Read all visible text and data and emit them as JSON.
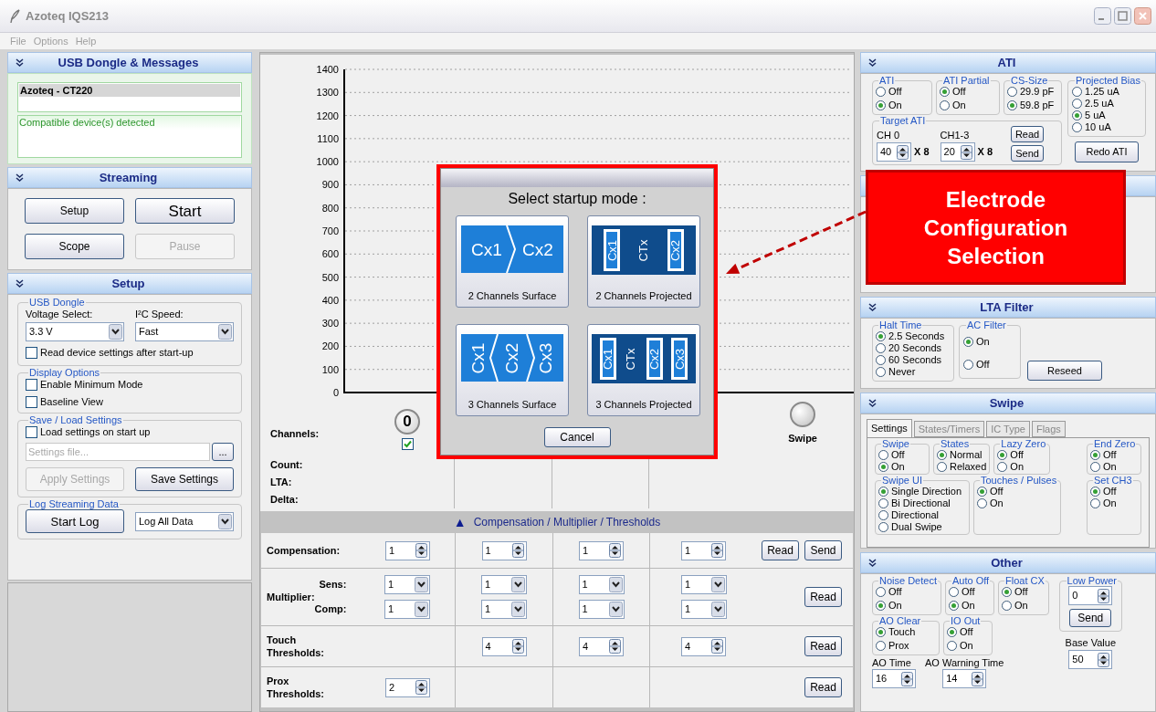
{
  "window": {
    "title": "Azoteq IQS213"
  },
  "menu": [
    "File",
    "Options",
    "Help"
  ],
  "usb_panel": {
    "title": "USB Dongle & Messages",
    "device": "Azoteq - CT220",
    "message": "Compatible device(s) detected"
  },
  "streaming_panel": {
    "title": "Streaming",
    "buttons": [
      {
        "label": "Setup",
        "disabled": false,
        "default": false
      },
      {
        "label": "Start",
        "disabled": false,
        "default": true
      },
      {
        "label": "Scope",
        "disabled": false,
        "default": false
      },
      {
        "label": "Pause",
        "disabled": true,
        "default": false
      }
    ]
  },
  "setup_panel": {
    "title": "Setup",
    "usb_dongle": {
      "title": "USB Dongle",
      "dropdowns": [
        {
          "label": "Voltage Select:",
          "value": "3.3 V"
        },
        {
          "label": "I²C Speed:",
          "value": "Fast"
        }
      ],
      "checkbox": {
        "label": "Read device settings after start-up",
        "checked": false
      }
    },
    "display_options": {
      "title": "Display Options",
      "checkboxes": [
        {
          "label": "Enable Minimum Mode",
          "checked": false
        },
        {
          "label": "Baseline View",
          "checked": false
        }
      ]
    },
    "save_load": {
      "title": "Save / Load Settings",
      "checkbox": {
        "label": "Load settings on start up",
        "checked": false
      },
      "file_field": {
        "placeholder": "Settings file..."
      },
      "browse_button": "...",
      "buttons": [
        {
          "label": "Apply Settings",
          "disabled": true
        },
        {
          "label": "Save Settings",
          "disabled": false
        }
      ]
    },
    "log_streaming": {
      "title": "Log Streaming Data",
      "button": "Start Log",
      "dropdown": "Log All Data"
    }
  },
  "chart": {
    "y_axis_labels": [
      "1400",
      "1300",
      "1200",
      "1100",
      "1000",
      "900",
      "800",
      "700",
      "600",
      "500",
      "400",
      "300",
      "200",
      "100",
      "0"
    ],
    "channels_label": "Channels:",
    "channel": {
      "number": "0",
      "checked": true
    },
    "swipe_label": "Swipe",
    "readouts": [
      "Count:",
      "LTA:",
      "Delta:"
    ]
  },
  "table": {
    "toggle": "▲",
    "title": "Compensation / Multiplier / Thresholds",
    "rows": [
      {
        "label": "Compensation:",
        "lines": [
          {
            "cells": [
              {
                "kind": "spin",
                "value": "1"
              },
              {
                "kind": "spin",
                "value": "1"
              },
              {
                "kind": "spin",
                "value": "1"
              },
              {
                "kind": "spin",
                "value": "1"
              }
            ]
          }
        ],
        "buttons": [
          "Read",
          "Send"
        ]
      },
      {
        "label": "Multiplier:",
        "lines": [
          {
            "sublabel": "Sens:",
            "cells": [
              {
                "kind": "dropdown",
                "value": "1"
              },
              {
                "kind": "dropdown",
                "value": "1"
              },
              {
                "kind": "dropdown",
                "value": "1"
              },
              {
                "kind": "dropdown",
                "value": "1"
              }
            ]
          },
          {
            "sublabel": "Comp:",
            "cells": [
              {
                "kind": "dropdown",
                "value": "1"
              },
              {
                "kind": "dropdown",
                "value": "1"
              },
              {
                "kind": "dropdown",
                "value": "1"
              },
              {
                "kind": "dropdown",
                "value": "1"
              }
            ]
          }
        ],
        "buttons": [
          "Read"
        ]
      },
      {
        "label": "Touch Thresholds:",
        "lines": [
          {
            "cells": [
              {
                "kind": "blank"
              },
              {
                "kind": "spin",
                "value": "4"
              },
              {
                "kind": "spin",
                "value": "4"
              },
              {
                "kind": "spin",
                "value": "4"
              }
            ]
          }
        ],
        "buttons": [
          "Read"
        ]
      },
      {
        "label": "Prox Thresholds:",
        "lines": [
          {
            "cells": [
              {
                "kind": "spin",
                "value": "2"
              },
              {
                "kind": "blank"
              },
              {
                "kind": "blank"
              },
              {
                "kind": "blank"
              }
            ]
          }
        ],
        "buttons": [
          "Read"
        ]
      }
    ]
  },
  "dialog": {
    "title": "Select startup mode :",
    "options": [
      {
        "label": "2 Channels Surface",
        "kind": "surface",
        "electrodes": [
          "Cx1",
          "Cx2"
        ]
      },
      {
        "label": "2 Channels Projected",
        "kind": "projected",
        "electrodes": [
          {
            "label": "Cx1",
            "kind": "sense"
          },
          {
            "label": "CTx",
            "kind": "drive"
          },
          {
            "label": "Cx2",
            "kind": "sense"
          }
        ]
      },
      {
        "label": "3 Channels Surface",
        "kind": "surface",
        "electrodes": [
          "Cx1",
          "Cx2",
          "Cx3"
        ]
      },
      {
        "label": "3 Channels Projected",
        "kind": "projected",
        "electrodes": [
          {
            "label": "Cx1",
            "kind": "sense"
          },
          {
            "label": "CTx",
            "kind": "drive"
          },
          {
            "label": "Cx2",
            "kind": "sense"
          },
          {
            "label": "Cx3",
            "kind": "sense"
          }
        ]
      }
    ],
    "cancel": "Cancel"
  },
  "callout": {
    "text": "Electrode Configuration Selection"
  },
  "ati_panel": {
    "title": "ATI",
    "groups": [
      {
        "title": "ATI",
        "options": [
          {
            "label": "Off",
            "selected": false
          },
          {
            "label": "On",
            "selected": true
          }
        ]
      },
      {
        "title": "ATI Partial",
        "options": [
          {
            "label": "Off",
            "selected": true
          },
          {
            "label": "On",
            "selected": false
          }
        ]
      },
      {
        "title": "CS-Size",
        "options": [
          {
            "label": "29.9 pF",
            "selected": false
          },
          {
            "label": "59.8 pF",
            "selected": true
          }
        ]
      }
    ],
    "target_ati": {
      "title": "Target ATI",
      "channels": [
        {
          "label": "CH 0",
          "value": "40",
          "unit": "X 8"
        },
        {
          "label": "CH1-3",
          "value": "20",
          "unit": "X 8"
        }
      ],
      "buttons": [
        "Read",
        "Send"
      ]
    },
    "bias": {
      "title": "Projected Bias",
      "options": [
        {
          "label": "1.25 uA",
          "selected": false
        },
        {
          "label": "2.5 uA",
          "selected": false
        },
        {
          "label": "5 uA",
          "selected": true
        },
        {
          "label": "10 uA",
          "selected": false
        }
      ]
    },
    "redo_button": "Redo ATI"
  },
  "lta_panel": {
    "title": "LTA Filter",
    "groups": [
      {
        "title": "Halt Time",
        "options": [
          {
            "label": "2.5 Seconds",
            "selected": true
          },
          {
            "label": "20 Seconds",
            "selected": false
          },
          {
            "label": "60 Seconds",
            "selected": false
          },
          {
            "label": "Never",
            "selected": false
          }
        ]
      },
      {
        "title": "AC Filter",
        "options": [
          {
            "label": "On",
            "selected": true
          },
          {
            "label": "Off",
            "selected": false
          }
        ]
      }
    ],
    "reseed_button": "Reseed"
  },
  "swipe_panel": {
    "title": "Swipe",
    "tabs": [
      {
        "label": "Settings",
        "selected": true
      },
      {
        "label": "States/Timers",
        "selected": false
      },
      {
        "label": "IC Type",
        "selected": false
      },
      {
        "label": "Flags",
        "selected": false
      }
    ],
    "groups": [
      {
        "title": "Swipe",
        "options": [
          {
            "label": "Off",
            "selected": false
          },
          {
            "label": "On",
            "selected": true
          }
        ]
      },
      {
        "title": "States",
        "options": [
          {
            "label": "Normal",
            "selected": true
          },
          {
            "label": "Relaxed",
            "selected": false
          }
        ]
      },
      {
        "title": "Lazy Zero",
        "options": [
          {
            "label": "Off",
            "selected": true
          },
          {
            "label": "On",
            "selected": false
          }
        ]
      },
      {
        "title": "End Zero",
        "options": [
          {
            "label": "Off",
            "selected": true
          },
          {
            "label": "On",
            "selected": false
          }
        ]
      },
      {
        "title": "Swipe UI",
        "options": [
          {
            "label": "Single Direction",
            "selected": true
          },
          {
            "label": "Bi Directional",
            "selected": false
          },
          {
            "label": "Directional",
            "selected": false
          },
          {
            "label": "Dual Swipe",
            "selected": false
          }
        ]
      },
      {
        "title": "Touches / Pulses",
        "options": [
          {
            "label": "Off",
            "selected": true
          },
          {
            "label": "On",
            "selected": false
          }
        ]
      },
      {
        "title": "Set CH3",
        "options": [
          {
            "label": "Off",
            "selected": true
          },
          {
            "label": "On",
            "selected": false
          }
        ]
      }
    ]
  },
  "other_panel": {
    "title": "Other",
    "groups": [
      {
        "title": "Noise Detect",
        "options": [
          {
            "label": "Off",
            "selected": false
          },
          {
            "label": "On",
            "selected": true
          }
        ]
      },
      {
        "title": "Auto Off",
        "options": [
          {
            "label": "Off",
            "selected": false
          },
          {
            "label": "On",
            "selected": true
          }
        ]
      },
      {
        "title": "Float CX",
        "options": [
          {
            "label": "Off",
            "selected": true
          },
          {
            "label": "On",
            "selected": false
          }
        ]
      },
      {
        "title": "AO Clear",
        "options": [
          {
            "label": "Touch",
            "selected": true
          },
          {
            "label": "Prox",
            "selected": false
          }
        ]
      },
      {
        "title": "IO Out",
        "options": [
          {
            "label": "Off",
            "selected": true
          },
          {
            "label": "On",
            "selected": false
          }
        ]
      }
    ],
    "low_power": {
      "title": "Low Power",
      "value": "0",
      "button": "Send"
    },
    "base_value": {
      "label": "Base Value",
      "value": "50"
    },
    "ao_time": {
      "label": "AO Time",
      "value": "16"
    },
    "ao_warning_time": {
      "label": "AO Warning Time",
      "value": "14"
    }
  }
}
